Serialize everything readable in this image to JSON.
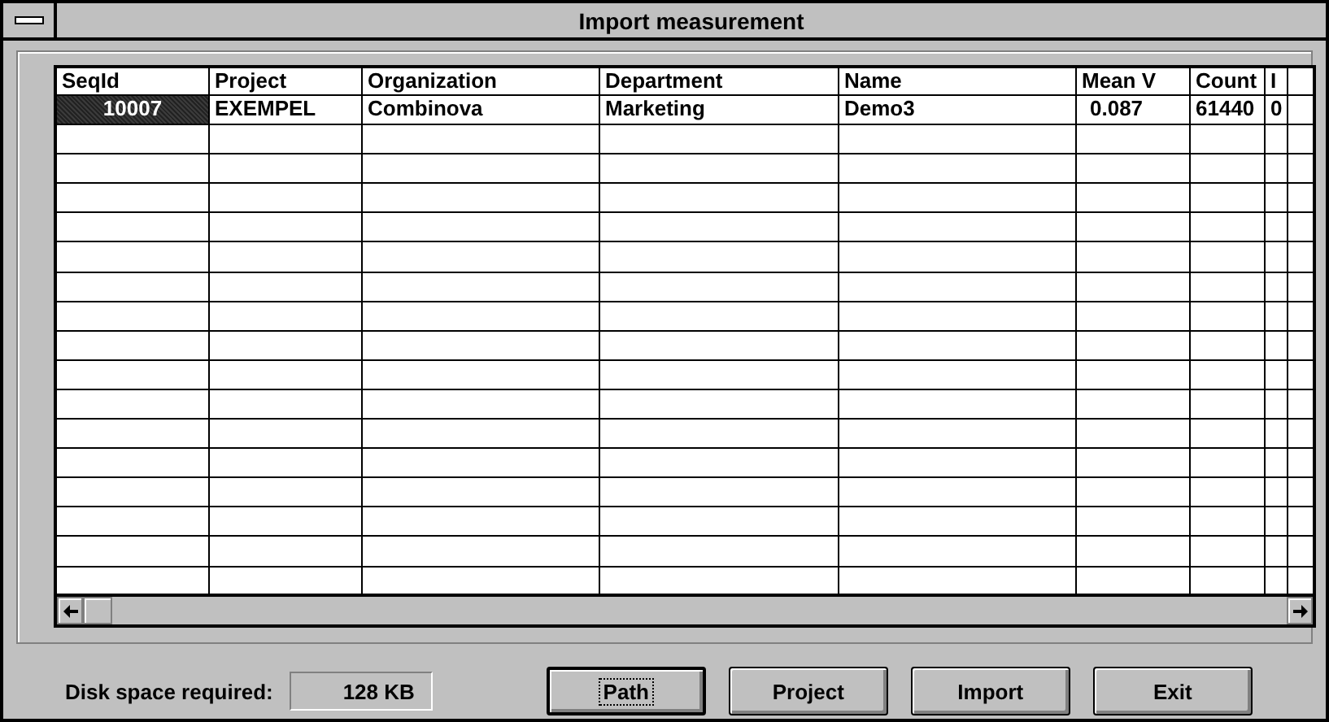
{
  "window": {
    "title": "Import measurement"
  },
  "table": {
    "columns": [
      "SeqId",
      "Project",
      "Organization",
      "Department",
      "Name",
      "Mean V",
      "Count",
      "I"
    ],
    "rows": [
      {
        "selected": true,
        "cells": [
          "10007",
          "EXEMPEL",
          "Combinova",
          "Marketing",
          "Demo3",
          "0.087",
          "61440",
          "0"
        ]
      }
    ]
  },
  "disk_space": {
    "label": "Disk space required:",
    "value": "128  KB"
  },
  "buttons": [
    {
      "label": "Path",
      "default": true
    },
    {
      "label": "Project",
      "default": false
    },
    {
      "label": "Import",
      "default": false
    },
    {
      "label": "Exit",
      "default": false
    }
  ]
}
